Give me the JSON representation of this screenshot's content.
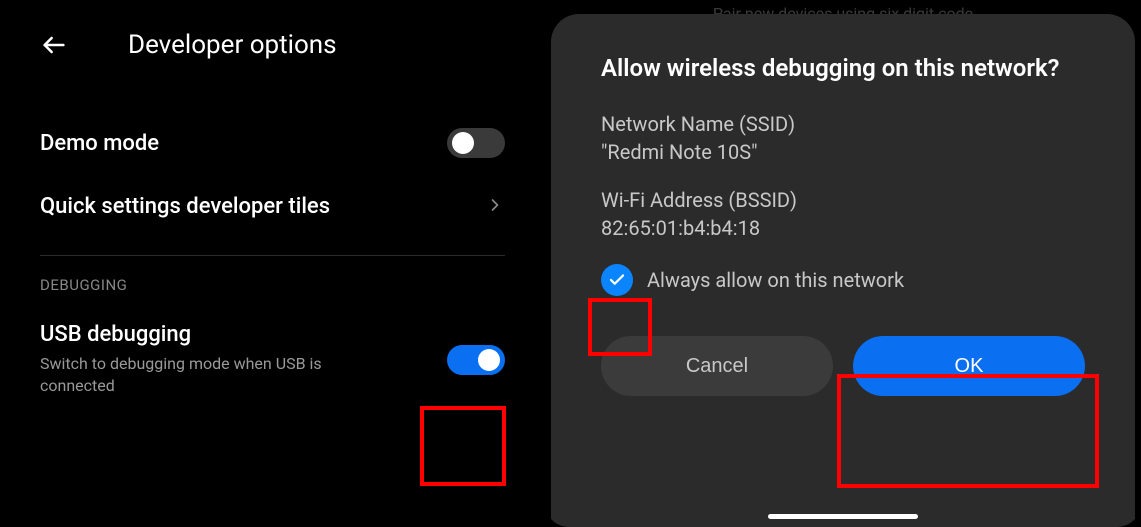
{
  "left": {
    "title": "Developer options",
    "demo_mode": {
      "label": "Demo mode",
      "enabled": false
    },
    "quick_tiles": {
      "label": "Quick settings developer tiles"
    },
    "section_header": "DEBUGGING",
    "usb_debugging": {
      "label": "USB debugging",
      "sub": "Switch to debugging mode when USB is connected",
      "enabled": true
    }
  },
  "right": {
    "background_hint": "Pair new devices using six digit code",
    "dialog_title": "Allow wireless debugging on this network?",
    "ssid_label": "Network Name (SSID)",
    "ssid_value": "\"Redmi Note 10S\"",
    "bssid_label": "Wi-Fi Address (BSSID)",
    "bssid_value": "82:65:01:b4:b4:18",
    "always_allow": {
      "label": "Always allow on this network",
      "checked": true
    },
    "buttons": {
      "cancel": "Cancel",
      "ok": "OK"
    }
  }
}
